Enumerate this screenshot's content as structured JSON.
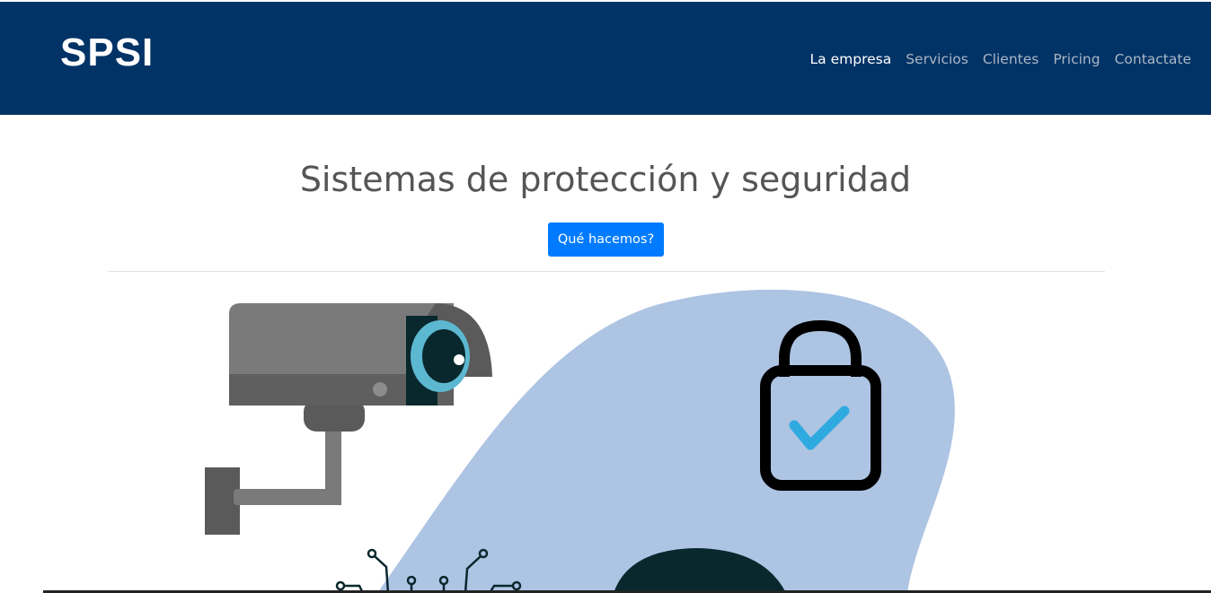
{
  "header": {
    "logo_text": "SPSI",
    "nav": [
      {
        "label": "La empresa",
        "active": true
      },
      {
        "label": "Servicios",
        "active": false
      },
      {
        "label": "Clientes",
        "active": false
      },
      {
        "label": "Pricing",
        "active": false
      },
      {
        "label": "Contactate",
        "active": false
      }
    ]
  },
  "hero": {
    "title": "Sistemas de protección y seguridad",
    "button_label": "Qué hacemos?"
  },
  "colors": {
    "navbar_bg": "#023366",
    "primary_button": "#007bff",
    "blob": "#adc4e3",
    "check": "#2eaae1"
  },
  "illustration": {
    "icons": [
      "security-camera-icon",
      "padlock-check-icon",
      "circuit-icon"
    ]
  }
}
